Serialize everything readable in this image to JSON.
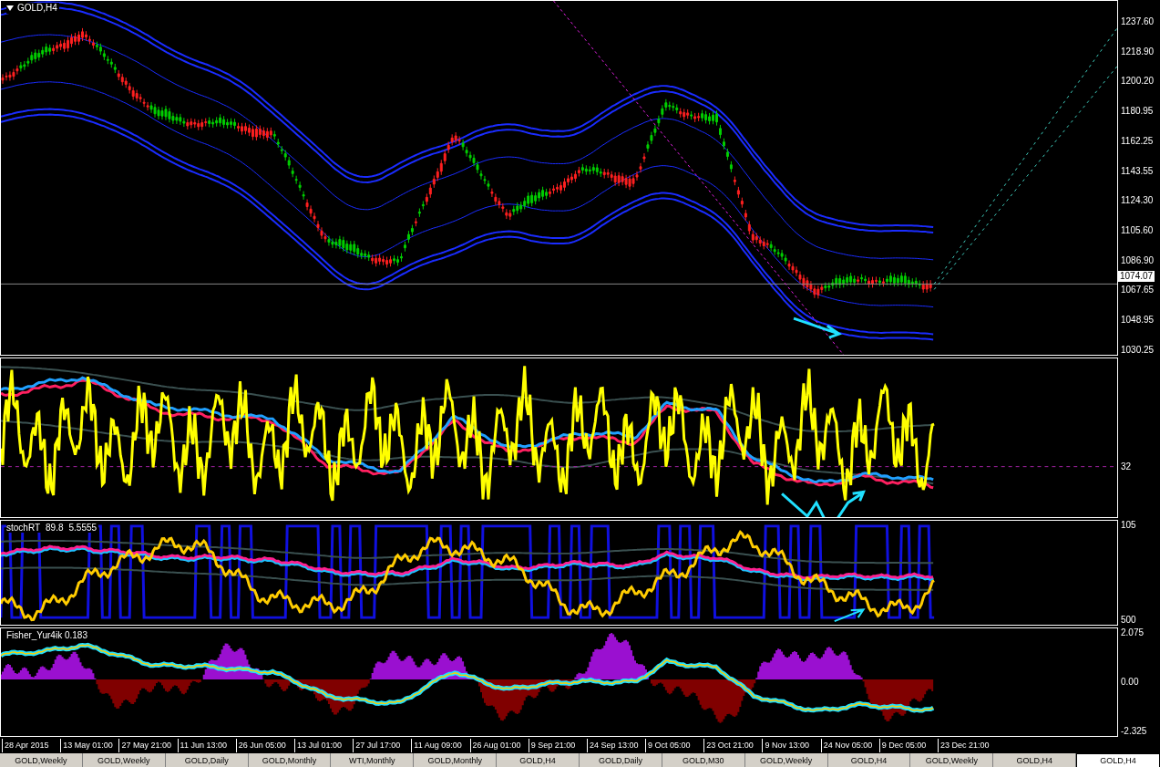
{
  "chart_title": "GOLD,H4",
  "price_axis": {
    "labels": [
      "1237.60",
      "1218.90",
      "1200.20",
      "1180.95",
      "1162.25",
      "1143.55",
      "1124.30",
      "1105.60",
      "1086.90",
      "1067.65",
      "1048.95",
      "1030.25"
    ],
    "current_price": "1074.07"
  },
  "oscillator_panel": {
    "axis_labels": [
      "32"
    ]
  },
  "stoch_panel": {
    "label_parts": [
      "stochRT",
      "89.8",
      "5.5555"
    ],
    "axis_labels": [
      "105",
      "500"
    ]
  },
  "fisher_panel": {
    "label": "Fisher_Yur4ik 0.183",
    "axis_labels": [
      "2.075",
      "0.00",
      "-2.325"
    ]
  },
  "time_axis": [
    "28 Apr 2015",
    "13 May 01:00",
    "27 May 21:00",
    "11 Jun 13:00",
    "26 Jun 05:00",
    "13 Jul 01:00",
    "27 Jul 17:00",
    "11 Aug 09:00",
    "26 Aug 01:00",
    "9 Sep 21:00",
    "24 Sep 13:00",
    "9 Oct 05:00",
    "23 Oct 21:00",
    "9 Nov 13:00",
    "24 Nov 05:00",
    "9 Dec 05:00",
    "23 Dec 21:00"
  ],
  "tabs": [
    {
      "label": "GOLD,Weekly",
      "selected": false
    },
    {
      "label": "GOLD,Weekly",
      "selected": false
    },
    {
      "label": "GOLD,Daily",
      "selected": false
    },
    {
      "label": "GOLD,Monthly",
      "selected": false
    },
    {
      "label": "WTI,Monthly",
      "selected": false
    },
    {
      "label": "GOLD,Monthly",
      "selected": false
    },
    {
      "label": "GOLD,H4",
      "selected": false
    },
    {
      "label": "GOLD,Daily",
      "selected": false
    },
    {
      "label": "GOLD,M30",
      "selected": false
    },
    {
      "label": "GOLD,Weekly",
      "selected": false
    },
    {
      "label": "GOLD,H4",
      "selected": false
    },
    {
      "label": "GOLD,Weekly",
      "selected": false
    },
    {
      "label": "GOLD,H4",
      "selected": false
    },
    {
      "label": "GOLD,H4",
      "selected": true
    }
  ]
}
